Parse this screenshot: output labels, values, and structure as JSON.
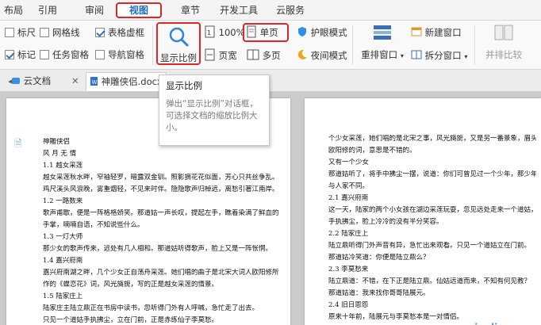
{
  "menu_tabs": [
    {
      "label": "布局"
    },
    {
      "label": "引用"
    },
    {
      "label": "审阅"
    },
    {
      "label": "视图"
    },
    {
      "label": "章节"
    },
    {
      "label": "开发工具"
    },
    {
      "label": "云服务"
    }
  ],
  "ribbon": {
    "checks": [
      {
        "label": "标尺",
        "checked": false
      },
      {
        "label": "网格线",
        "checked": false
      },
      {
        "label": "表格虚框",
        "checked": true
      },
      {
        "label": "标记",
        "checked": true
      },
      {
        "label": "任务窗格",
        "checked": false
      },
      {
        "label": "导航窗格",
        "checked": false
      }
    ],
    "zoom_label": "显示比例",
    "zoom_value": "100%",
    "page_width_label": "页宽",
    "single_page_label": "单页",
    "multi_page_label": "多页",
    "eye_mode_label": "护眼模式",
    "night_mode_label": "夜间模式",
    "rearrange_label": "重排窗口",
    "new_window_label": "新建窗口",
    "split_window_label": "拆分窗口",
    "side_by_side_label": "并排比较"
  },
  "doc_tabs": [
    {
      "label": "云文档"
    },
    {
      "label": "神雕侠侣.docx"
    }
  ],
  "tooltip": {
    "title": "显示比例",
    "body": "弹出“显示比例”对话框，可选择文档的缩放比例大小。"
  },
  "left_page_lines": [
    "神雕侠侣",
    "风  月  无  情",
    "1.1  越女采莲",
    "越女采莲秋水畔，窄袖轻罗，暗露双金钏。照影摘花花似面，芳心只共丝争乱。",
    "鸡尺溪头风浪晚，雾重烟轻，不见来时伴。隐隐歌声归棹远，离愁引著江南岸。",
    "1.2  一路数来",
    "歌声甫歇，便是一阵格格娇笑。那道姑一声长叹，提起左手，瞧着染满了鲜血的",
    "手掌，喃喃自语，不知说些什么。",
    "1.3  一灯大师",
    "那少女的歌声传来，远处有几人相和。那道姑听得歌声，脸上又是一阵怅惘。",
    "1.4  嘉兴府南",
    "嘉兴府南湖之畔，几个少女正自荡舟采莲。她们唱的曲子是北宋大词人欧阳修所",
    "作的《蝶恋花》词，风光旖旎，写的正是越女采莲的情景。",
    "1.5  陆家庄上",
    "陆家庄主陆立鼎正在书房中读书，忽听得门外有人呼喊，急忙走了出去。",
    "只见一个道姑手执拂尘，立在门前，正是赤练仙子李莫愁。"
  ],
  "right_page_lines": [
    "个少女采莲，她们唱的是北宋之事，风光旖旎，又是另一番景象，眉头一皱。",
    "欧阳修的词，意思是不错的。",
    "又有一个少女",
    "那道姑听了，将手中拂尘一摆，说道：你们可曾见过一个少年，那少年的神情",
    "与人家不同。",
    "2.1  嘉兴府南",
    "这一天，陆家的两个小女孩在湖边采莲玩耍，忽见远处走来一个道姑，",
    "手执拂尘，脸上冷冷的没有半分笑容。",
    "2.2  陆家庄上",
    "陆立鼎听得门外声音有异，急忙出来观看。只见一个道姑立在门前。",
    "那道姑冷笑道：你便是陆立鼎么？",
    "2.3  李莫愁来",
    "陆立鼎道：不错，在下正是陆立鼎。仙姑远道而来，不知有何见教？",
    "那道姑道：我来找你哥哥陆展元。",
    "2.4  旧日恩怨",
    "原来十年前，陆展元与李莫愁本是一对情侣。"
  ]
}
